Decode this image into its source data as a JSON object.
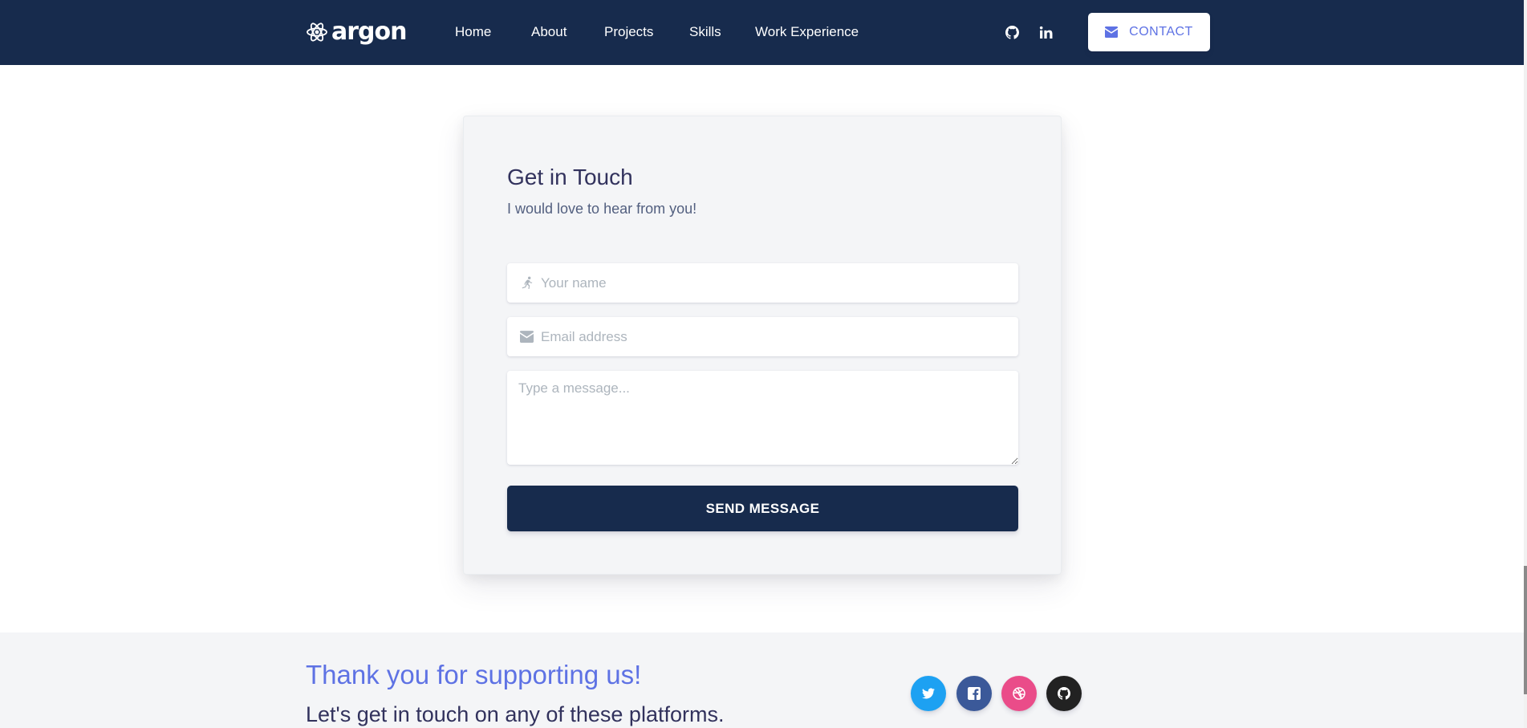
{
  "navbar": {
    "brand": "argon",
    "links": [
      {
        "label": "Home"
      },
      {
        "label": "About"
      },
      {
        "label": "Projects"
      },
      {
        "label": "Skills"
      },
      {
        "label": "Work Experience"
      }
    ],
    "social_icons": [
      "github-icon",
      "linkedin-icon"
    ],
    "contact_label": "CONTACT",
    "background_color": "#172b4d"
  },
  "contact_form": {
    "title": "Get in Touch",
    "subtitle": "I would love to hear from you!",
    "name_placeholder": "Your name",
    "email_placeholder": "Email address",
    "message_placeholder": "Type a message...",
    "submit_label": "SEND MESSAGE",
    "accent_color": "#5e72e4"
  },
  "footer": {
    "title": "Thank you for supporting us!",
    "subtitle": "Let's get in touch on any of these platforms.",
    "social_buttons": [
      {
        "icon": "twitter-icon",
        "color": "#1da1f2"
      },
      {
        "icon": "facebook-icon",
        "color": "#3b5999"
      },
      {
        "icon": "dribbble-icon",
        "color": "#ea4c89"
      },
      {
        "icon": "github-icon",
        "color": "#222222"
      }
    ]
  }
}
